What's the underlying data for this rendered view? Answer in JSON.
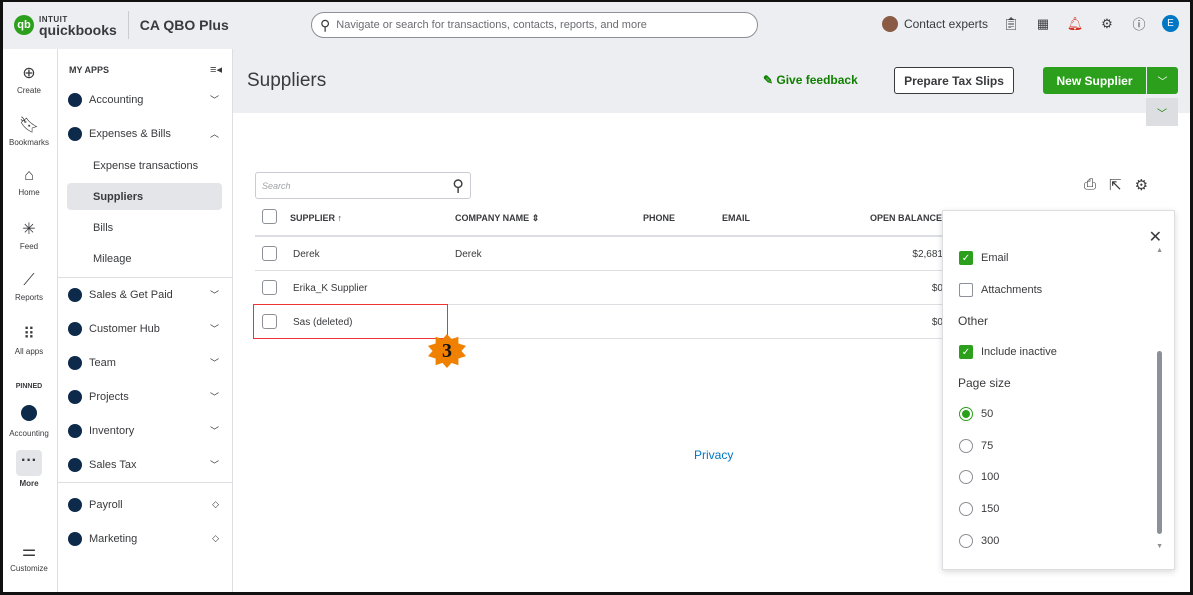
{
  "header": {
    "logo_top": "INTUIT",
    "logo_bottom": "quickbooks",
    "company": "CA QBO Plus",
    "search_placeholder": "Navigate or search for transactions, contacts, reports, and more",
    "contact": "Contact experts",
    "user_initial": "E"
  },
  "rail": [
    {
      "label": "Create"
    },
    {
      "label": "Bookmarks"
    },
    {
      "label": "Home"
    },
    {
      "label": "Feed"
    },
    {
      "label": "Reports"
    },
    {
      "label": "All apps"
    },
    {
      "label": "PINNED"
    },
    {
      "label": "Accounting"
    },
    {
      "label": "More"
    },
    {
      "label": "Customize"
    }
  ],
  "sidebar": {
    "heading": "MY APPS",
    "items": [
      {
        "label": "Accounting",
        "color": "#0d2a4a"
      },
      {
        "label": "Expenses & Bills",
        "color": "#0d2a4a"
      },
      {
        "label": "Sales & Get Paid",
        "color": "#0d2a4a"
      },
      {
        "label": "Customer Hub",
        "color": "#0d2a4a"
      },
      {
        "label": "Team",
        "color": "#0d2a4a"
      },
      {
        "label": "Projects",
        "color": "#0d2a4a"
      },
      {
        "label": "Inventory",
        "color": "#0d2a4a"
      },
      {
        "label": "Sales Tax",
        "color": "#0d2a4a"
      },
      {
        "label": "Payroll",
        "color": "#0d2a4a"
      },
      {
        "label": "Marketing",
        "color": "#0d2a4a"
      }
    ],
    "sub": [
      "Expense transactions",
      "Suppliers",
      "Bills",
      "Mileage"
    ]
  },
  "page": {
    "title": "Suppliers",
    "feedback": "Give feedback",
    "prepare": "Prepare Tax Slips",
    "new_supplier": "New Supplier",
    "search_placeholder": "Search",
    "privacy": "Privacy",
    "step_badge": "3"
  },
  "table": {
    "headers": [
      "SUPPLIER",
      "COMPANY NAME",
      "PHONE",
      "EMAIL",
      "OPEN BALANCE"
    ],
    "rows": [
      {
        "supplier": "Derek",
        "company": "Derek",
        "balance": "$2,681"
      },
      {
        "supplier": "Erika_K Supplier",
        "company": "",
        "balance": "$0"
      },
      {
        "supplier": "Sas (deleted)",
        "company": "",
        "balance": "$0"
      }
    ]
  },
  "settings": {
    "email": "Email",
    "attachments": "Attachments",
    "other": "Other",
    "include_inactive": "Include inactive",
    "page_size": "Page size",
    "sizes": [
      "50",
      "75",
      "100",
      "150",
      "300"
    ],
    "selected_size": "50"
  }
}
